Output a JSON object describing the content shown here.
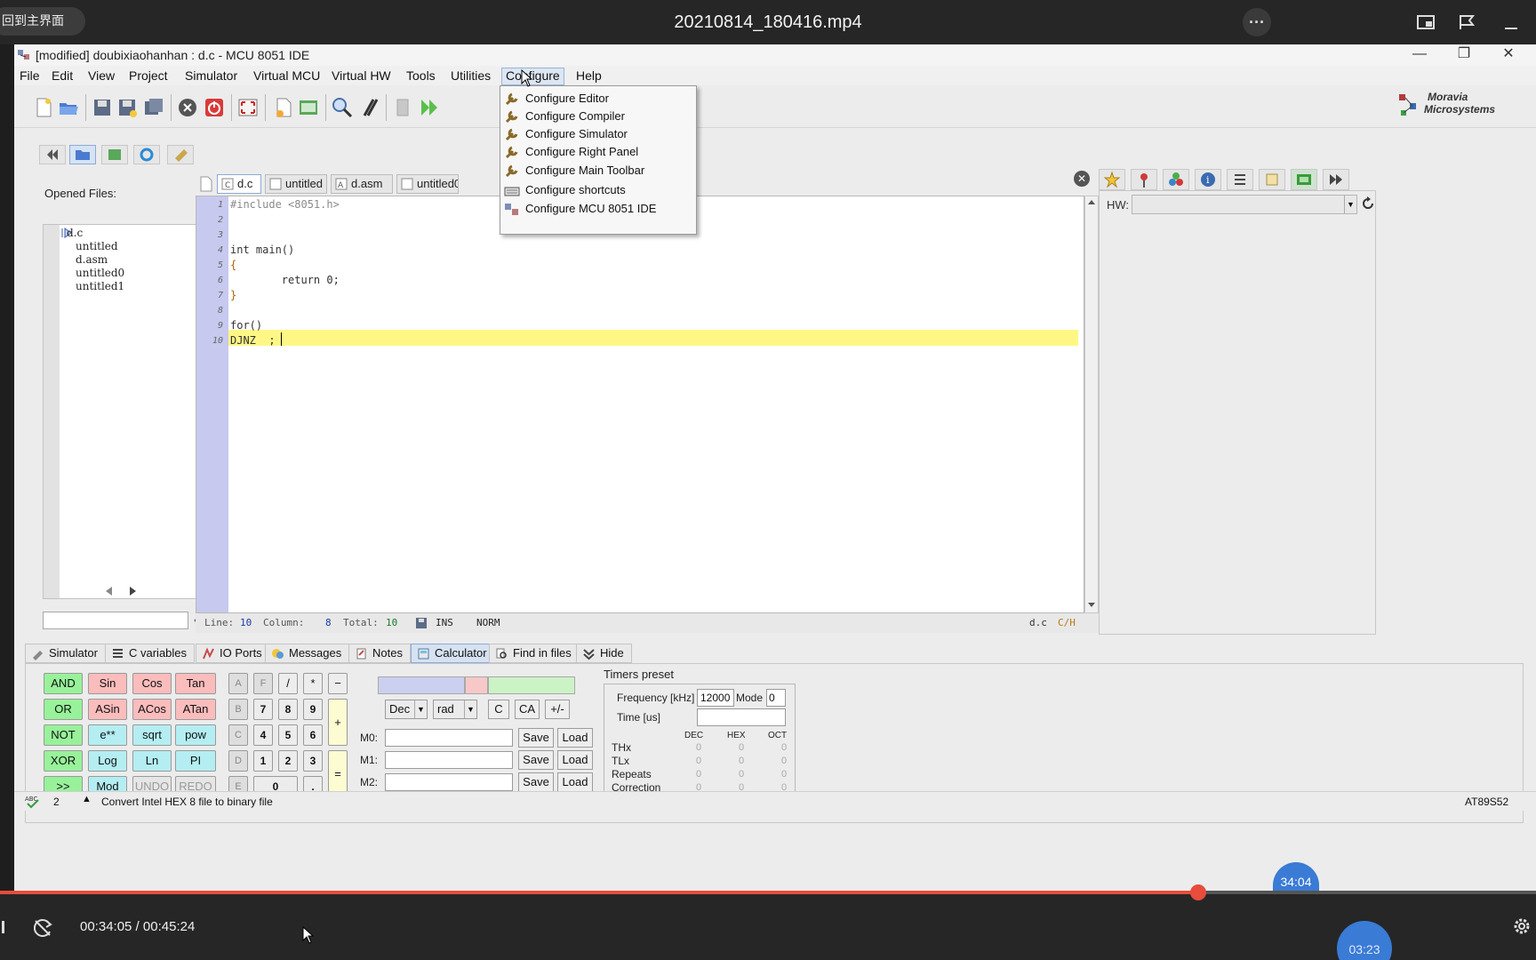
{
  "player": {
    "back_label": "回到主界面",
    "title": "20210814_180416.mp4",
    "more_label": "···",
    "current_time": "00:34:05",
    "separator": " / ",
    "total_time": "00:45:24",
    "progress_fraction": 0.78,
    "hover_time": "34:04",
    "bubble_time": "03:23"
  },
  "window": {
    "title": "[modified] doubixiaohanhan : d.c - MCU 8051 IDE",
    "minimize": "—",
    "maximize": "❐",
    "close": "✕"
  },
  "menubar": {
    "items": [
      "File",
      "Edit",
      "View",
      "Project",
      "Simulator",
      "Virtual MCU",
      "Virtual HW",
      "Tools",
      "Utilities",
      "Configure",
      "Help"
    ],
    "active": "Configure"
  },
  "configure_menu": {
    "items": [
      "Configure Editor",
      "Configure Compiler",
      "Configure Simulator",
      "Configure Right Panel",
      "Configure Main Toolbar",
      "Configure shortcuts",
      "Configure MCU 8051 IDE"
    ]
  },
  "logo": {
    "line1": "Moravia",
    "line2": "Microsystems"
  },
  "left_panel": {
    "label": "Opened Files:",
    "files": [
      "d.c",
      "untitled",
      "d.asm",
      "untitled0",
      "untitled1"
    ]
  },
  "editor": {
    "tabs": [
      "d.c",
      "untitled",
      "d.asm",
      "untitled0"
    ],
    "line_numbers": [
      "1",
      "2",
      "3",
      "4",
      "5",
      "6",
      "7",
      "8",
      "9",
      "10"
    ],
    "lines": [
      {
        "text": "#include <8051.h>",
        "color": "#8a8a8a"
      },
      {
        "text": "",
        "color": "#000"
      },
      {
        "text": "",
        "color": "#000"
      },
      {
        "text": "int main()",
        "color": "#333333"
      },
      {
        "text": "{",
        "color": "#b06000"
      },
      {
        "text": "        return 0;",
        "color": "#333333"
      },
      {
        "text": "}",
        "color": "#b06000"
      },
      {
        "text": "",
        "color": "#000"
      },
      {
        "text": "for()",
        "color": "#333333"
      },
      {
        "text": "DJNZ  ;",
        "color": "#333333"
      }
    ],
    "status": {
      "line_label": "Line:",
      "line": "10",
      "col_label": "Column:",
      "col": "8",
      "total_label": "Total:",
      "total": "10",
      "mode1": "INS",
      "mode2": "NORM",
      "file": "d.c",
      "type": "C/H"
    }
  },
  "right_panel": {
    "hw_label": "HW:"
  },
  "bottom_tabs": [
    "Simulator",
    "C variables",
    "IO Ports",
    "Messages",
    "Notes",
    "Calculator",
    "Find in files",
    "Hide"
  ],
  "calculator": {
    "func_rows": [
      [
        "AND",
        "Sin",
        "Cos",
        "Tan"
      ],
      [
        "OR",
        "ASin",
        "ACos",
        "ATan"
      ],
      [
        "NOT",
        "e**",
        "sqrt",
        "pow"
      ],
      [
        "XOR",
        "Log",
        "Ln",
        "PI"
      ],
      [
        ">>",
        "Mod",
        "UNDO",
        "REDO"
      ]
    ],
    "hex_keys": [
      "A",
      "B",
      "C",
      "D",
      "E",
      "F"
    ],
    "digits": [
      "7",
      "8",
      "9",
      "4",
      "5",
      "6",
      "1",
      "2",
      "3",
      "0",
      "."
    ],
    "ops": [
      "/",
      "*",
      "−",
      "+",
      "="
    ],
    "base": "Dec",
    "angle": "rad",
    "clear": "C",
    "clear_all": "CA",
    "sign": "+/-",
    "memory": [
      "M0:",
      "M1:",
      "M2:"
    ],
    "save": "Save",
    "load": "Load"
  },
  "timers": {
    "title": "Timers preset",
    "freq_label": "Frequency [kHz]",
    "freq_value": "12000",
    "mode_label": "Mode",
    "mode_value": "0",
    "time_label": "Time [us]",
    "cols": [
      "DEC",
      "HEX",
      "OCT"
    ],
    "rows": [
      "THx",
      "TLx",
      "Repeats",
      "Correction"
    ],
    "zero": "0"
  },
  "app_status": {
    "count": "2",
    "message": "Convert Intel HEX 8 file to binary file",
    "mcu": "AT89S52"
  }
}
